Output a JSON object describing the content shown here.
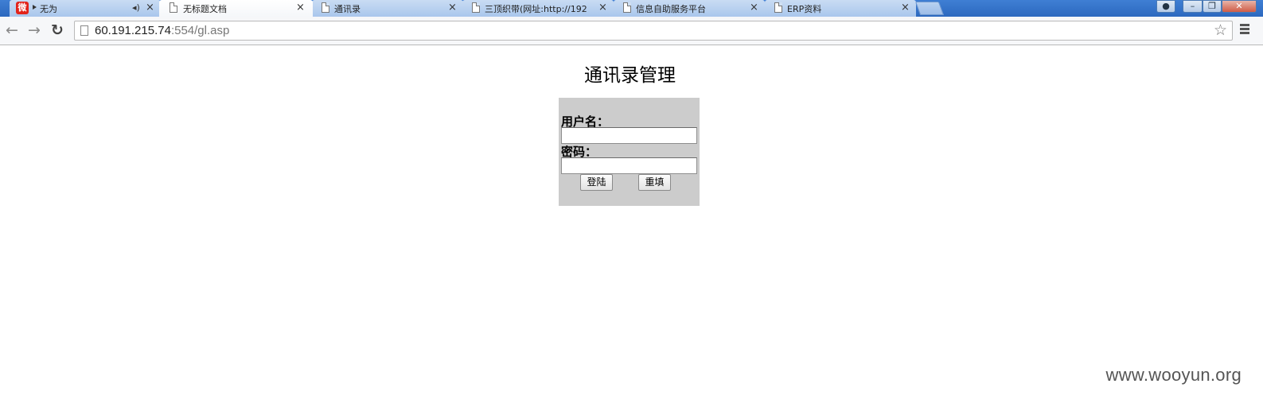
{
  "browser": {
    "tabs": [
      {
        "title": "无为",
        "close": "×"
      },
      {
        "title": "无标题文档",
        "close": "×"
      },
      {
        "title": "通讯录",
        "close": "×"
      },
      {
        "title": "三顶织带(网址:http://192",
        "close": "×"
      },
      {
        "title": "信息自助服务平台",
        "close": "×"
      },
      {
        "title": "ERP资料",
        "close": "×"
      }
    ],
    "url_host": "60.191.215.74",
    "url_rest": ":554/gl.asp"
  },
  "page": {
    "title": "通讯录管理",
    "username_label": "用户名：",
    "password_label": "密码：",
    "username_value": "",
    "password_value": "",
    "login_button": "登陆",
    "reset_button": "重填",
    "background_color": "#cccccc"
  },
  "watermark": "www.wooyun.org"
}
